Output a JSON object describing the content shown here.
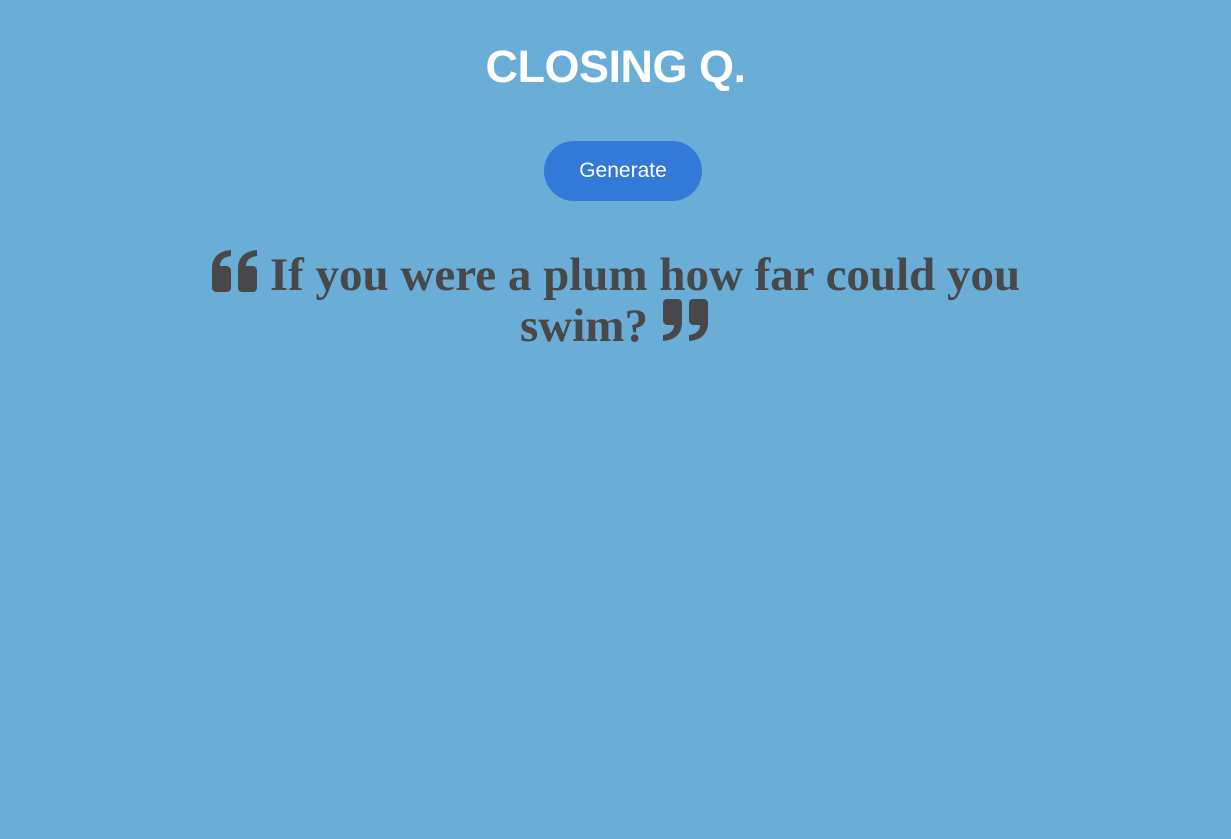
{
  "header": {
    "title": "CLOSING Q."
  },
  "actions": {
    "generate_label": "Generate"
  },
  "quote": {
    "text": "If you were a plum how far could you swim?",
    "open_icon": "quote-open-icon",
    "close_icon": "quote-close-icon"
  },
  "colors": {
    "background": "#6aadd7",
    "button": "#3379d8",
    "quote_text": "#484749",
    "title_text": "#ffffff"
  }
}
